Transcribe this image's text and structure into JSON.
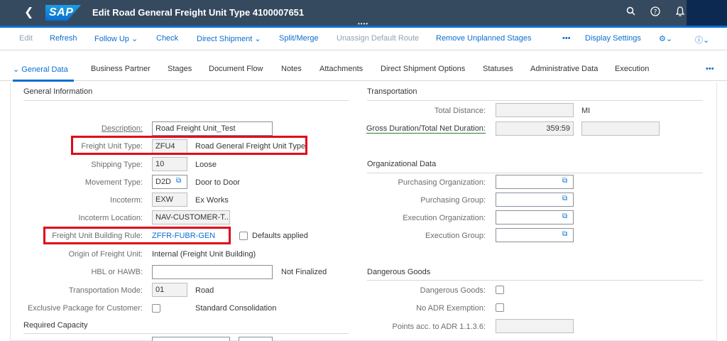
{
  "shell": {
    "title": "Edit Road General Freight Unit Type 4100007651",
    "logo": "SAP",
    "icons": [
      "back-icon",
      "search-icon",
      "help-icon",
      "bell-icon"
    ]
  },
  "toolbar": {
    "edit": "Edit",
    "refresh": "Refresh",
    "follow_up": "Follow Up",
    "check": "Check",
    "direct_shipment": "Direct Shipment",
    "split_merge": "Split/Merge",
    "unassign_default_route": "Unassign Default Route",
    "remove_unplanned_stages": "Remove Unplanned Stages",
    "more": "•••",
    "display_settings": "Display Settings"
  },
  "tabs": [
    "General Data",
    "Business Partner",
    "Stages",
    "Document Flow",
    "Notes",
    "Attachments",
    "Direct Shipment Options",
    "Statuses",
    "Administrative Data",
    "Execution"
  ],
  "tabs_more": "•••",
  "general": {
    "title": "General Information",
    "description_label": "Description:",
    "description_value": "Road Freight Unit_Test",
    "fu_type_label": "Freight Unit Type:",
    "fu_type_code": "ZFU4",
    "fu_type_text": "Road General Freight Unit Type",
    "shipping_type_label": "Shipping Type:",
    "shipping_type_code": "10",
    "shipping_type_text": "Loose",
    "movement_type_label": "Movement Type:",
    "movement_type_code": "D2D",
    "movement_type_text": "Door to Door",
    "incoterm_label": "Incoterm:",
    "incoterm_code": "EXW",
    "incoterm_text": "Ex Works",
    "incoterm_location_label": "Incoterm Location:",
    "incoterm_location_value": "NAV-CUSTOMER-T...",
    "fubr_label": "Freight Unit Building Rule:",
    "fubr_value": "ZFFR-FUBR-GEN",
    "defaults_applied": "Defaults applied",
    "origin_label": "Origin of Freight Unit:",
    "origin_value": "Internal (Freight Unit Building)",
    "hbl_label": "HBL or HAWB:",
    "hbl_value": "",
    "hbl_status": "Not Finalized",
    "transport_mode_label": "Transportation Mode:",
    "transport_mode_code": "01",
    "transport_mode_text": "Road",
    "exclusive_label": "Exclusive Package for Customer:",
    "standard_consolidation": "Standard Consolidation"
  },
  "required_capacity": {
    "title": "Required Capacity"
  },
  "transportation": {
    "title": "Transportation",
    "total_distance_label": "Total Distance:",
    "total_distance_value": "",
    "total_distance_unit": "MI",
    "gross_duration_label": "Gross Duration/Total Net Duration:",
    "gross_duration_value": "359:59",
    "net_duration_value": ""
  },
  "org": {
    "title": "Organizational Data",
    "purch_org_label": "Purchasing Organization:",
    "purch_group_label": "Purchasing Group:",
    "exec_org_label": "Execution Organization:",
    "exec_group_label": "Execution Group:"
  },
  "dangerous": {
    "title": "Dangerous Goods",
    "dg_label": "Dangerous Goods:",
    "no_adr_label": "No ADR Exemption:",
    "points_label": "Points acc. to ADR 1.1.3.6:"
  }
}
